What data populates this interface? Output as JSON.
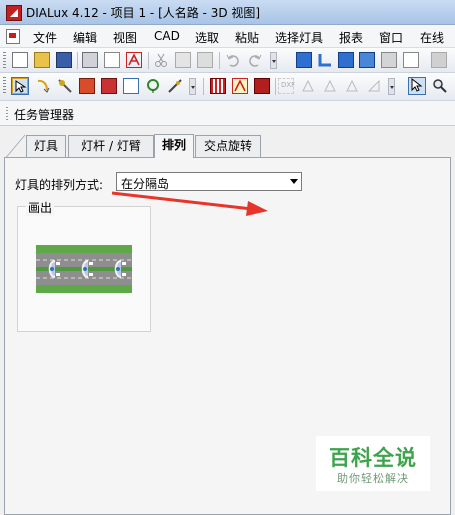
{
  "window": {
    "title": "DIALux 4.12 - 项目 1 - [人名路 - 3D 视图]"
  },
  "menu": {
    "items": [
      {
        "label": "文件"
      },
      {
        "label": "编辑"
      },
      {
        "label": "视图"
      },
      {
        "label": "CAD"
      },
      {
        "label": "选取"
      },
      {
        "label": "粘贴"
      },
      {
        "label": "选择灯具"
      },
      {
        "label": "报表"
      },
      {
        "label": "窗口"
      },
      {
        "label": "在线"
      }
    ]
  },
  "toolbar": {
    "dxf_label": "DXF"
  },
  "task_manager": {
    "title": "任务管理器"
  },
  "tabs": [
    {
      "label": "灯具",
      "active": false
    },
    {
      "label": "灯杆 / 灯臂",
      "active": false
    },
    {
      "label": "排列",
      "active": true
    },
    {
      "label": "交点旋转",
      "active": false
    }
  ],
  "arrangement": {
    "label": "灯具的排列方式:",
    "selected": "在分隔岛"
  },
  "preview": {
    "label": "画出"
  },
  "annotation": {
    "arrow_color": "#e8352b"
  },
  "watermark": {
    "title": "百科全说",
    "subtitle": "助你轻松解决"
  }
}
